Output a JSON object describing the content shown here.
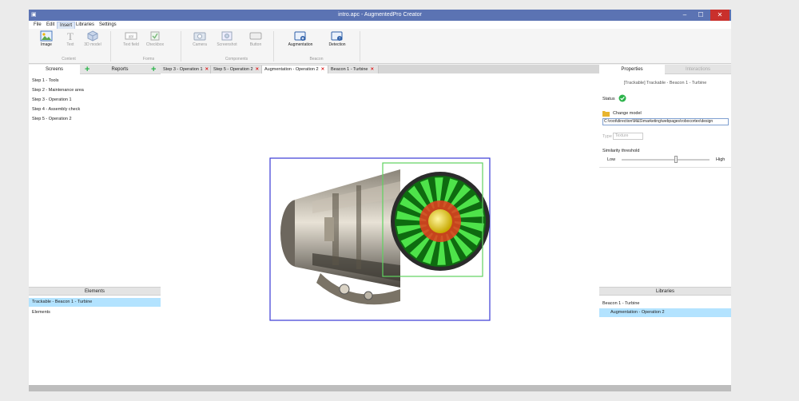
{
  "window": {
    "title": "intro.apc - AugmentedPro Creator"
  },
  "menu": [
    "File",
    "Edit",
    "Insert",
    "Libraries",
    "Settings"
  ],
  "ribbon": {
    "content": {
      "group": "Content",
      "image": "Image",
      "text": "Text",
      "model3d": "3D model"
    },
    "forms": {
      "group": "Forms",
      "textfield": "Text field",
      "checkbox": "Checkbox"
    },
    "components": {
      "group": "Components",
      "camera": "Camera",
      "screenshot": "Screenshot",
      "button": "Button"
    },
    "beacon": {
      "group": "Beacon",
      "augmentation": "Augmentation",
      "detection": "Detection"
    }
  },
  "left_panel": {
    "tabs": {
      "screens": "Screens",
      "reports": "Reports"
    },
    "screens": [
      "Step 1 - Tools",
      "Step 2 - Maintenance area",
      "Step 3 - Operation 1",
      "Step 4 - Assembly check",
      "Step 5 - Operation 2"
    ],
    "elements_header": "Elements",
    "elements_selected": "Trackable - Beacon 1 - Turbine",
    "elements_item": "Elements"
  },
  "doc_tabs": [
    "Step 3 - Operation 1",
    "Step 5 - Operation 2",
    "Augmentation - Operation 2",
    "Beacon 1 - Turbine"
  ],
  "right_panel": {
    "tabs": {
      "properties": "Properties",
      "interactions": "Interactions"
    },
    "heading": "[Trackable] Trackable - Beacon 1 - Turbine",
    "status_label": "Status",
    "change_model": "Change model",
    "model_path": "C:\\root\\direction\\M&S\\marketing\\webpages\\robocortex\\design",
    "type_label": "Type",
    "type_value": "Texture",
    "similarity_label": "Similarity threshold",
    "low": "Low",
    "high": "High",
    "similarity_value": 0.62,
    "libraries_header": "Libraries",
    "libraries": [
      "Beacon 1 - Turbine",
      "Augmentation - Operation 2"
    ]
  },
  "colors": {
    "titlebar": "#5b73b3",
    "selection": "#b3e3ff",
    "accent_green": "#2bb34a",
    "bounding_blue": "#3a3ad6",
    "tracking_green": "#5fd35f"
  }
}
